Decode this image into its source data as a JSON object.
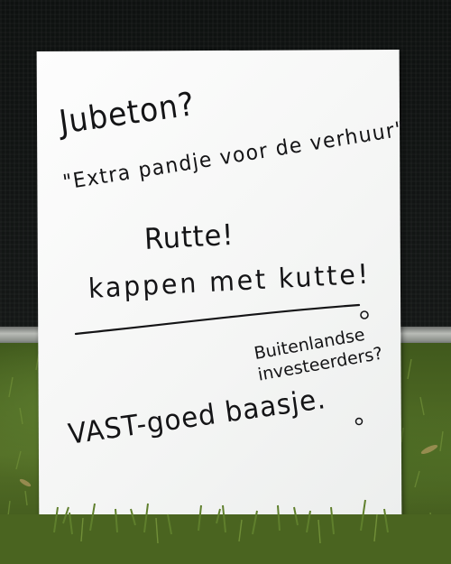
{
  "sign": {
    "lines": [
      "Jubeton?",
      "\"Extra pandje voor de verhuur\"",
      "Rutte!",
      "kappen met kutte!",
      "Buitenlandse investeerders?",
      "VAST-goed baasje."
    ]
  },
  "colors": {
    "board": "#f7f8f7",
    "ink": "#141416",
    "grass": "#4f6a23",
    "backdrop": "#0e1110"
  }
}
